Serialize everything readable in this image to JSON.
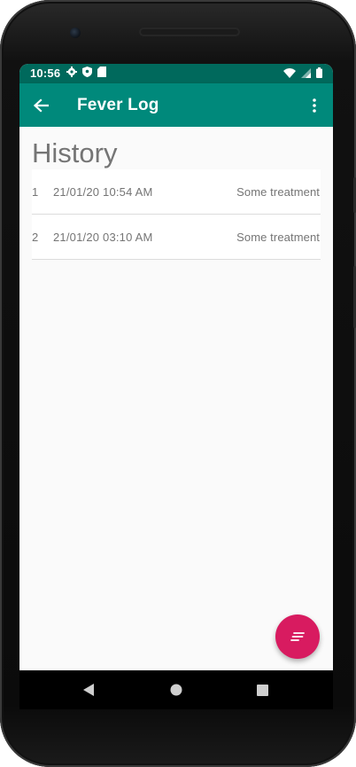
{
  "status_bar": {
    "time": "10:56",
    "left_icons": [
      "gear-icon",
      "shield-icon",
      "sd-card-icon"
    ],
    "right_icons": [
      "wifi-icon",
      "signal-icon",
      "battery-icon"
    ],
    "color": "#00695c"
  },
  "app_bar": {
    "title": "Fever Log",
    "color": "#00897b"
  },
  "page": {
    "title": "History"
  },
  "history": [
    {
      "index": "1",
      "timestamp": "21/01/20 10:54 AM",
      "treatment": "Some treatment"
    },
    {
      "index": "2",
      "timestamp": "21/01/20 03:10 AM",
      "treatment": "Some treatment"
    }
  ],
  "fab": {
    "icon": "notes-icon",
    "color": "#d81b60"
  },
  "nav_bar": {
    "icons": [
      "back-triangle-icon",
      "home-circle-icon",
      "recents-square-icon"
    ]
  }
}
